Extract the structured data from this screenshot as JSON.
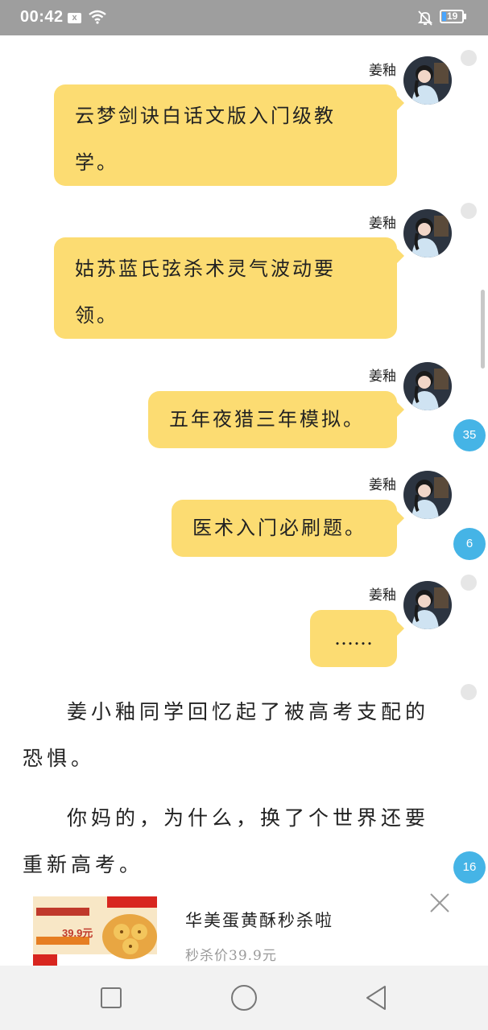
{
  "status_bar": {
    "time": "00:42",
    "notif_icon": "x",
    "battery_level": "19",
    "icons": [
      "close-notification-icon",
      "wifi-icon",
      "bell-muted-icon",
      "battery-icon"
    ]
  },
  "messages": [
    {
      "sender": "姜釉",
      "text": "云梦剑诀白话文版入门级教学。",
      "badge": ""
    },
    {
      "sender": "姜釉",
      "text": "姑苏蓝氏弦杀术灵气波动要领。",
      "badge": ""
    },
    {
      "sender": "姜釉",
      "text": "五年夜猎三年模拟。",
      "badge": "35"
    },
    {
      "sender": "姜釉",
      "text": "医术入门必刷题。",
      "badge": "6"
    },
    {
      "sender": "姜釉",
      "text": "……",
      "badge": ""
    }
  ],
  "paragraphs": [
    {
      "text": "姜小釉同学回忆起了被高考支配的恐惧。",
      "badge": ""
    },
    {
      "text": "你妈的，为什么，换了个世界还要重新高考。",
      "badge": "16"
    }
  ],
  "ad": {
    "title": "华美蛋黄酥秒杀啦",
    "price": "秒杀价39.9元",
    "image_caption": "39.9元"
  },
  "navbar": {
    "icons": [
      "recent-apps-icon",
      "home-icon",
      "back-icon"
    ]
  },
  "colors": {
    "bubble": "#fcdc72",
    "badge": "#45b4e6",
    "status_bar": "#9e9e9e"
  }
}
